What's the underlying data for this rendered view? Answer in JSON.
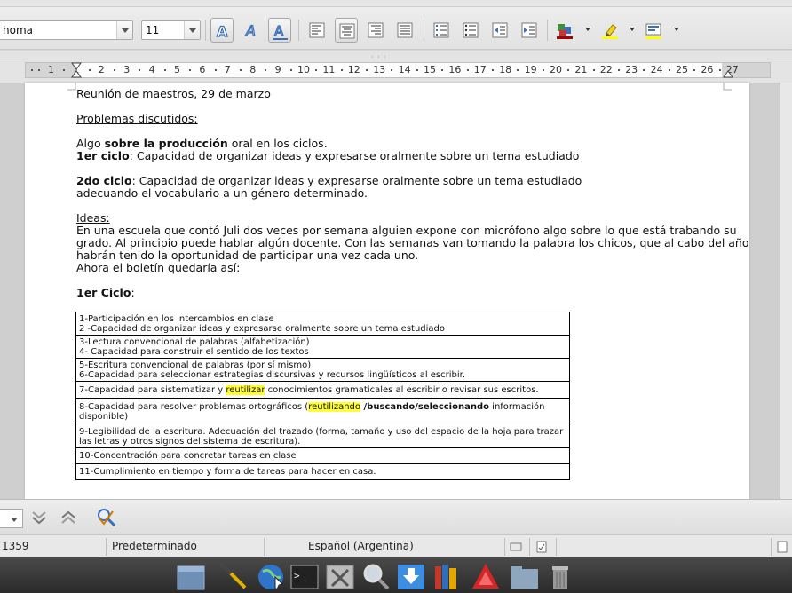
{
  "toolbar": {
    "font_name": "homa",
    "font_size": "11"
  },
  "ruler": {
    "ticks": [
      "1",
      "1",
      "2",
      "3",
      "4",
      "5",
      "6",
      "7",
      "8",
      "9",
      "10",
      "11",
      "12",
      "13",
      "14",
      "15",
      "16",
      "17",
      "18",
      "19",
      "20",
      "21",
      "22",
      "23",
      "24",
      "25",
      "26",
      "27"
    ],
    "handle_marks": "· · ·"
  },
  "document": {
    "line1": "Reunión de maestros, 29 de marzo",
    "line2": "Problemas discutidos:",
    "line3_a": "Algo ",
    "line3_b": "sobre la producción",
    "line3_c": " oral en los ciclos.",
    "line4_a": "1er ciclo",
    "line4_b": ": Capacidad de organizar ideas y expresarse oralmente sobre un tema estudiado",
    "line5_a": "2do ciclo",
    "line5_b": ": Capacidad de organizar ideas y expresarse oralmente sobre un tema estudiado",
    "line6": "adecuando el vocabulario a un género determinado.",
    "line7": "Ideas:",
    "line8": "En una escuela que contó Juli dos veces por semana alguien expone con micrófono algo sobre lo que está trabando su",
    "line9": "grado. Al principio puede hablar algún docente. Con las semanas van tomando la palabra los chicos, que al cabo del año",
    "line10": "habrán tenido la oportunidad de participar una vez cada uno.",
    "line11": "Ahora el boletín quedaría así:",
    "line12_a": "1er Ciclo",
    "line12_b": ":"
  },
  "table": {
    "r1a": "1-Participación en los intercambios en clase",
    "r1b": "2 -Capacidad de organizar ideas y expresarse oralmente sobre un tema estudiado",
    "r2a": "3-Lectura convencional de palabras (alfabetización)",
    "r2b": "4- Capacidad para construir el sentido de los textos",
    "r3a": "5-Escritura convencional de palabras (por sí mismo)",
    "r3b": "6-Capacidad para seleccionar estrategias discursivas y recursos lingüísticos al escribir.",
    "r4a": "7-Capacidad para sistematizar y ",
    "r4b": "reutilizar",
    "r4c": " conocimientos gramaticales al escribir o revisar sus escritos.",
    "r5a": "8-Capacidad para resolver problemas ortográficos (",
    "r5b": "reutilizando",
    "r5c": " /buscando/seleccionando",
    "r5d": " información",
    "r5e": "disponible)",
    "r6a": "9-Legibilidad de la escritura. Adecuación del trazado (forma,  tamaño y uso del espacio de la hoja para trazar",
    "r6b": "las  letras y otros signos del sistema de escritura).",
    "r7": "10-Concentración para concretar tareas en clase",
    "r8": "11-Cumplimiento en tiempo y forma de tareas para hacer en casa."
  },
  "status": {
    "words": "1359",
    "page_style": "Predeterminado",
    "language": "Español (Argentina)"
  },
  "colors": {
    "highlight": "#ffff33",
    "taskbar": "#333333"
  }
}
